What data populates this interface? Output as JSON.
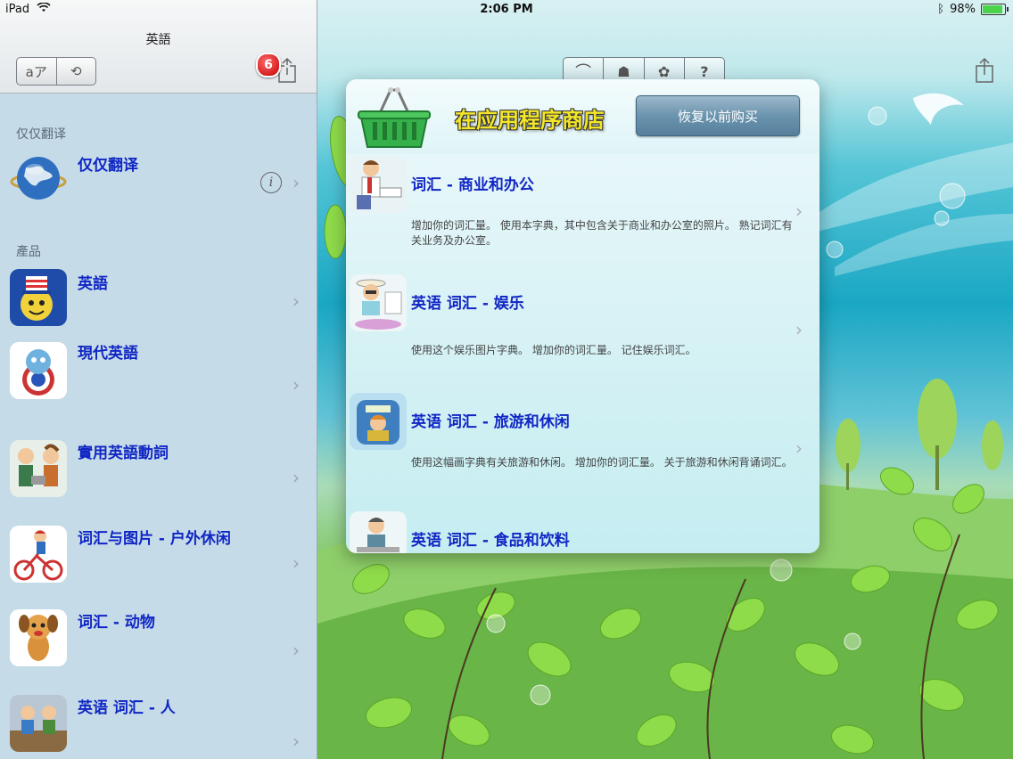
{
  "status_bar": {
    "device": "iPad",
    "time": "2:06 PM",
    "battery_percent": "98%"
  },
  "master": {
    "title": "英語",
    "segment_labels": [
      "aア",
      "⟲"
    ],
    "notification_count": "6",
    "section_translate": "仅仅翻译",
    "translate_item": {
      "title": "仅仅翻译"
    },
    "section_products": "產品",
    "products": [
      {
        "title": "英語"
      },
      {
        "title": "現代英語"
      },
      {
        "title": "實用英語動詞"
      },
      {
        "title": "词汇与图片 - 户外休闲"
      },
      {
        "title": "词汇 - 动物"
      },
      {
        "title": "英语 词汇 - 人"
      }
    ]
  },
  "store": {
    "title": "在应用程序商店",
    "restore_label": "恢复以前购买",
    "items": [
      {
        "title": "词汇 - 商业和办公",
        "description": "增加你的词汇量。 使用本字典，其中包含关于商业和办公室的照片。 熟记词汇有关业务及办公室。"
      },
      {
        "title": "英语 词汇 - 娱乐",
        "description": "使用这个娱乐图片字典。 增加你的词汇量。 记住娱乐词汇。"
      },
      {
        "title": "英语 词汇 - 旅游和休闲",
        "description": "使用这幅画字典有关旅游和休闲。 增加你的词汇量。 关于旅游和休闲背诵词汇。"
      },
      {
        "title": "英语 词汇 - 食品和饮料",
        "description": ""
      }
    ]
  },
  "colors": {
    "link_blue": "#1026c4",
    "title_yellow": "#f3e629",
    "badge_red": "#d00000"
  }
}
